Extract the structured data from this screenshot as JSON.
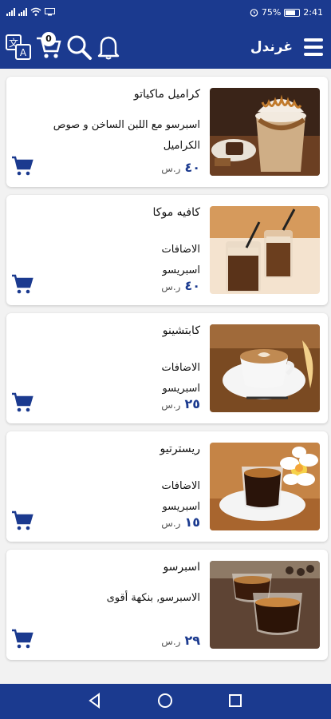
{
  "status": {
    "left_icons": [
      "signal-icon",
      "signal-icon",
      "wifi-icon",
      "screen-icon"
    ],
    "battery": "75%",
    "time": "2:41"
  },
  "app": {
    "title": "غرندل",
    "cart_count": "0",
    "icons": [
      "menu-icon",
      "translate-icon",
      "cart-icon",
      "search-icon",
      "bell-icon"
    ]
  },
  "items": [
    {
      "name": "كراميل ماكياتو",
      "description": "اسبرسو مع اللبن الساخن و صوص الكراميل",
      "price": "٤٠",
      "currency": "ر.س"
    },
    {
      "name": "كافيه موكا",
      "extras_label": "الاضافات",
      "extras_value": "اسبريسو",
      "price": "٤٠",
      "currency": "ر.س"
    },
    {
      "name": "كابتشينو",
      "extras_label": "الاضافات",
      "extras_value": "اسبريسو",
      "price": "٢٥",
      "currency": "ر.س"
    },
    {
      "name": "ريسترتيو",
      "extras_label": "الاضافات",
      "extras_value": "اسبريسو",
      "price": "١٥",
      "currency": "ر.س"
    },
    {
      "name": "اسبرسو",
      "description": "الاسبرسو, بنكهة أقوى",
      "price": "٢٩",
      "currency": "ر.س"
    }
  ],
  "colors": {
    "primary": "#1b3a8f",
    "card": "#ffffff",
    "background": "#f2f2f2"
  },
  "nav": [
    "back-icon",
    "home-icon",
    "recents-icon"
  ]
}
